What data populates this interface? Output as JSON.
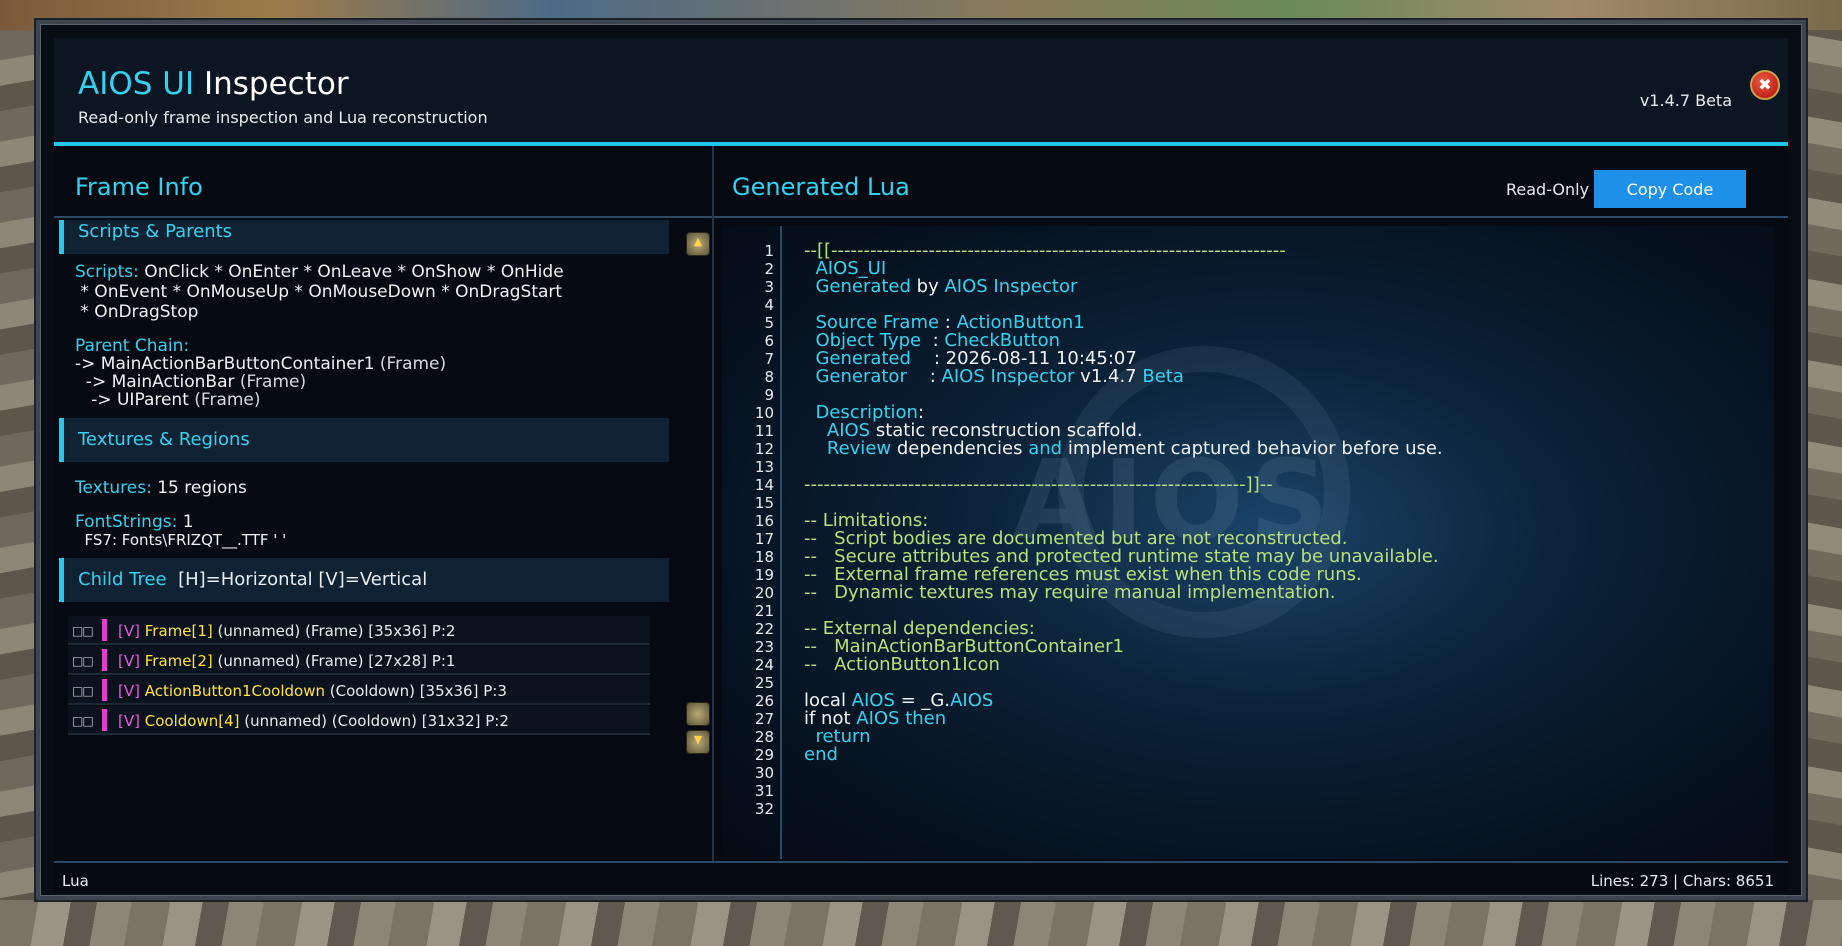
{
  "window": {
    "title_accent": "AIOS UI",
    "title_rest": " Inspector",
    "subtitle": "Read-only frame inspection and Lua reconstruction",
    "version": "v1.4.7 Beta",
    "close_icon": "✖"
  },
  "left": {
    "title": "Frame Info",
    "sections": {
      "scripts": "Scripts & Parents",
      "textures": "Textures & Regions",
      "child_tree": "Child Tree",
      "child_tree_hint": "[H]=Horizontal  [V]=Vertical"
    },
    "scripts_label": "Scripts:",
    "scripts_line1": " OnClick * OnEnter * OnLeave * OnShow * OnHide",
    "scripts_line2": " * OnEvent * OnMouseUp * OnMouseDown * OnDragStart",
    "scripts_line3": " * OnDragStop",
    "parent_label": "Parent Chain:",
    "parent1_name": "-> MainActionBarButtonContainer1",
    "parent1_type": " (Frame)",
    "parent2_name": "  -> MainActionBar",
    "parent2_type": " (Frame)",
    "parent3_name": "   -> UIParent",
    "parent3_type": " (Frame)",
    "textures_label": "Textures:",
    "textures_value": " 15 regions",
    "fontstrings_label": "FontStrings:",
    "fontstrings_value": " 1",
    "fontstring_detail": "  FS7: Fonts\\FRIZQT__.TTF ' '",
    "tree": [
      {
        "box": "□□",
        "flag": "[V]",
        "name": "Frame[1]",
        "rest": " (unnamed) (Frame) [35x36] P:2"
      },
      {
        "box": "□□",
        "flag": "[V]",
        "name": "Frame[2]",
        "rest": " (unnamed) (Frame) [27x28] P:1"
      },
      {
        "box": "□□",
        "flag": "[V]",
        "name": "ActionButton1Cooldown",
        "rest": " (Cooldown) [35x36] P:3"
      },
      {
        "box": "□□",
        "flag": "[V]",
        "name": "Cooldown[4]",
        "rest": " (unnamed) (Cooldown) [31x32] P:2"
      }
    ],
    "scroll_up_icon": "▲",
    "scroll_down_icon": "▼"
  },
  "right": {
    "title": "Generated Lua",
    "readonly_label": "Read-Only",
    "copy_label": "Copy Code",
    "line_numbers": [
      "1",
      "2",
      "3",
      "4",
      "5",
      "6",
      "7",
      "8",
      "9",
      "10",
      "11",
      "12",
      "13",
      "14",
      "15",
      "16",
      "17",
      "18",
      "19",
      "20",
      "21",
      "22",
      "23",
      "24",
      "25",
      "26",
      "27",
      "28",
      "29",
      "30",
      "31",
      "32"
    ],
    "code": {
      "l1": "--[[----------------------------------------------------------------------",
      "l2": "  AIOS_UI",
      "l3a": "  Generated",
      "l3b": " by ",
      "l3c": "AIOS Inspector",
      "l5a": "  Source Frame",
      "l5b": " : ",
      "l5c": "ActionButton1",
      "l6a": "  Object Type",
      "l6b": "  : ",
      "l6c": "CheckButton",
      "l7a": "  Generated",
      "l7b": "    : 2026-08-11 10:45:07",
      "l8a": "  Generator",
      "l8b": "    : ",
      "l8c": "AIOS Inspector",
      "l8d": " v1.4.7 ",
      "l8e": "Beta",
      "l10": "  Description",
      "l10b": ":",
      "l11a": "    AIOS",
      "l11b": " static reconstruction scaffold.",
      "l12a": "    Review",
      "l12b": " dependencies ",
      "l12c": "and",
      "l12d": " implement captured behavior before use.",
      "l14": "--------------------------------------------------------------------]]--",
      "l16": "-- Limitations:",
      "l17": "--   Script bodies are documented but are not reconstructed.",
      "l18": "--   Secure attributes and protected runtime state may be unavailable.",
      "l19": "--   External frame references must exist when this code runs.",
      "l20": "--   Dynamic textures may require manual implementation.",
      "l22": "-- External dependencies:",
      "l23": "--   MainActionBarButtonContainer1",
      "l24": "--   ActionButton1Icon",
      "l26a": "local ",
      "l26b": "AIOS",
      "l26c": " = _G.",
      "l26d": "AIOS",
      "l27a": "if not ",
      "l27b": "AIOS",
      "l27c": " then",
      "l28": "  return",
      "l29": "end"
    }
  },
  "footer": {
    "language": "Lua",
    "stats": "Lines: 273 | Chars: 8651"
  },
  "colors": {
    "accent": "#35d2ef",
    "copy_button": "#1f90e8",
    "comment": "#b7e07a",
    "tree_name": "#ffe23a",
    "tree_flag": "#e85ad8"
  }
}
